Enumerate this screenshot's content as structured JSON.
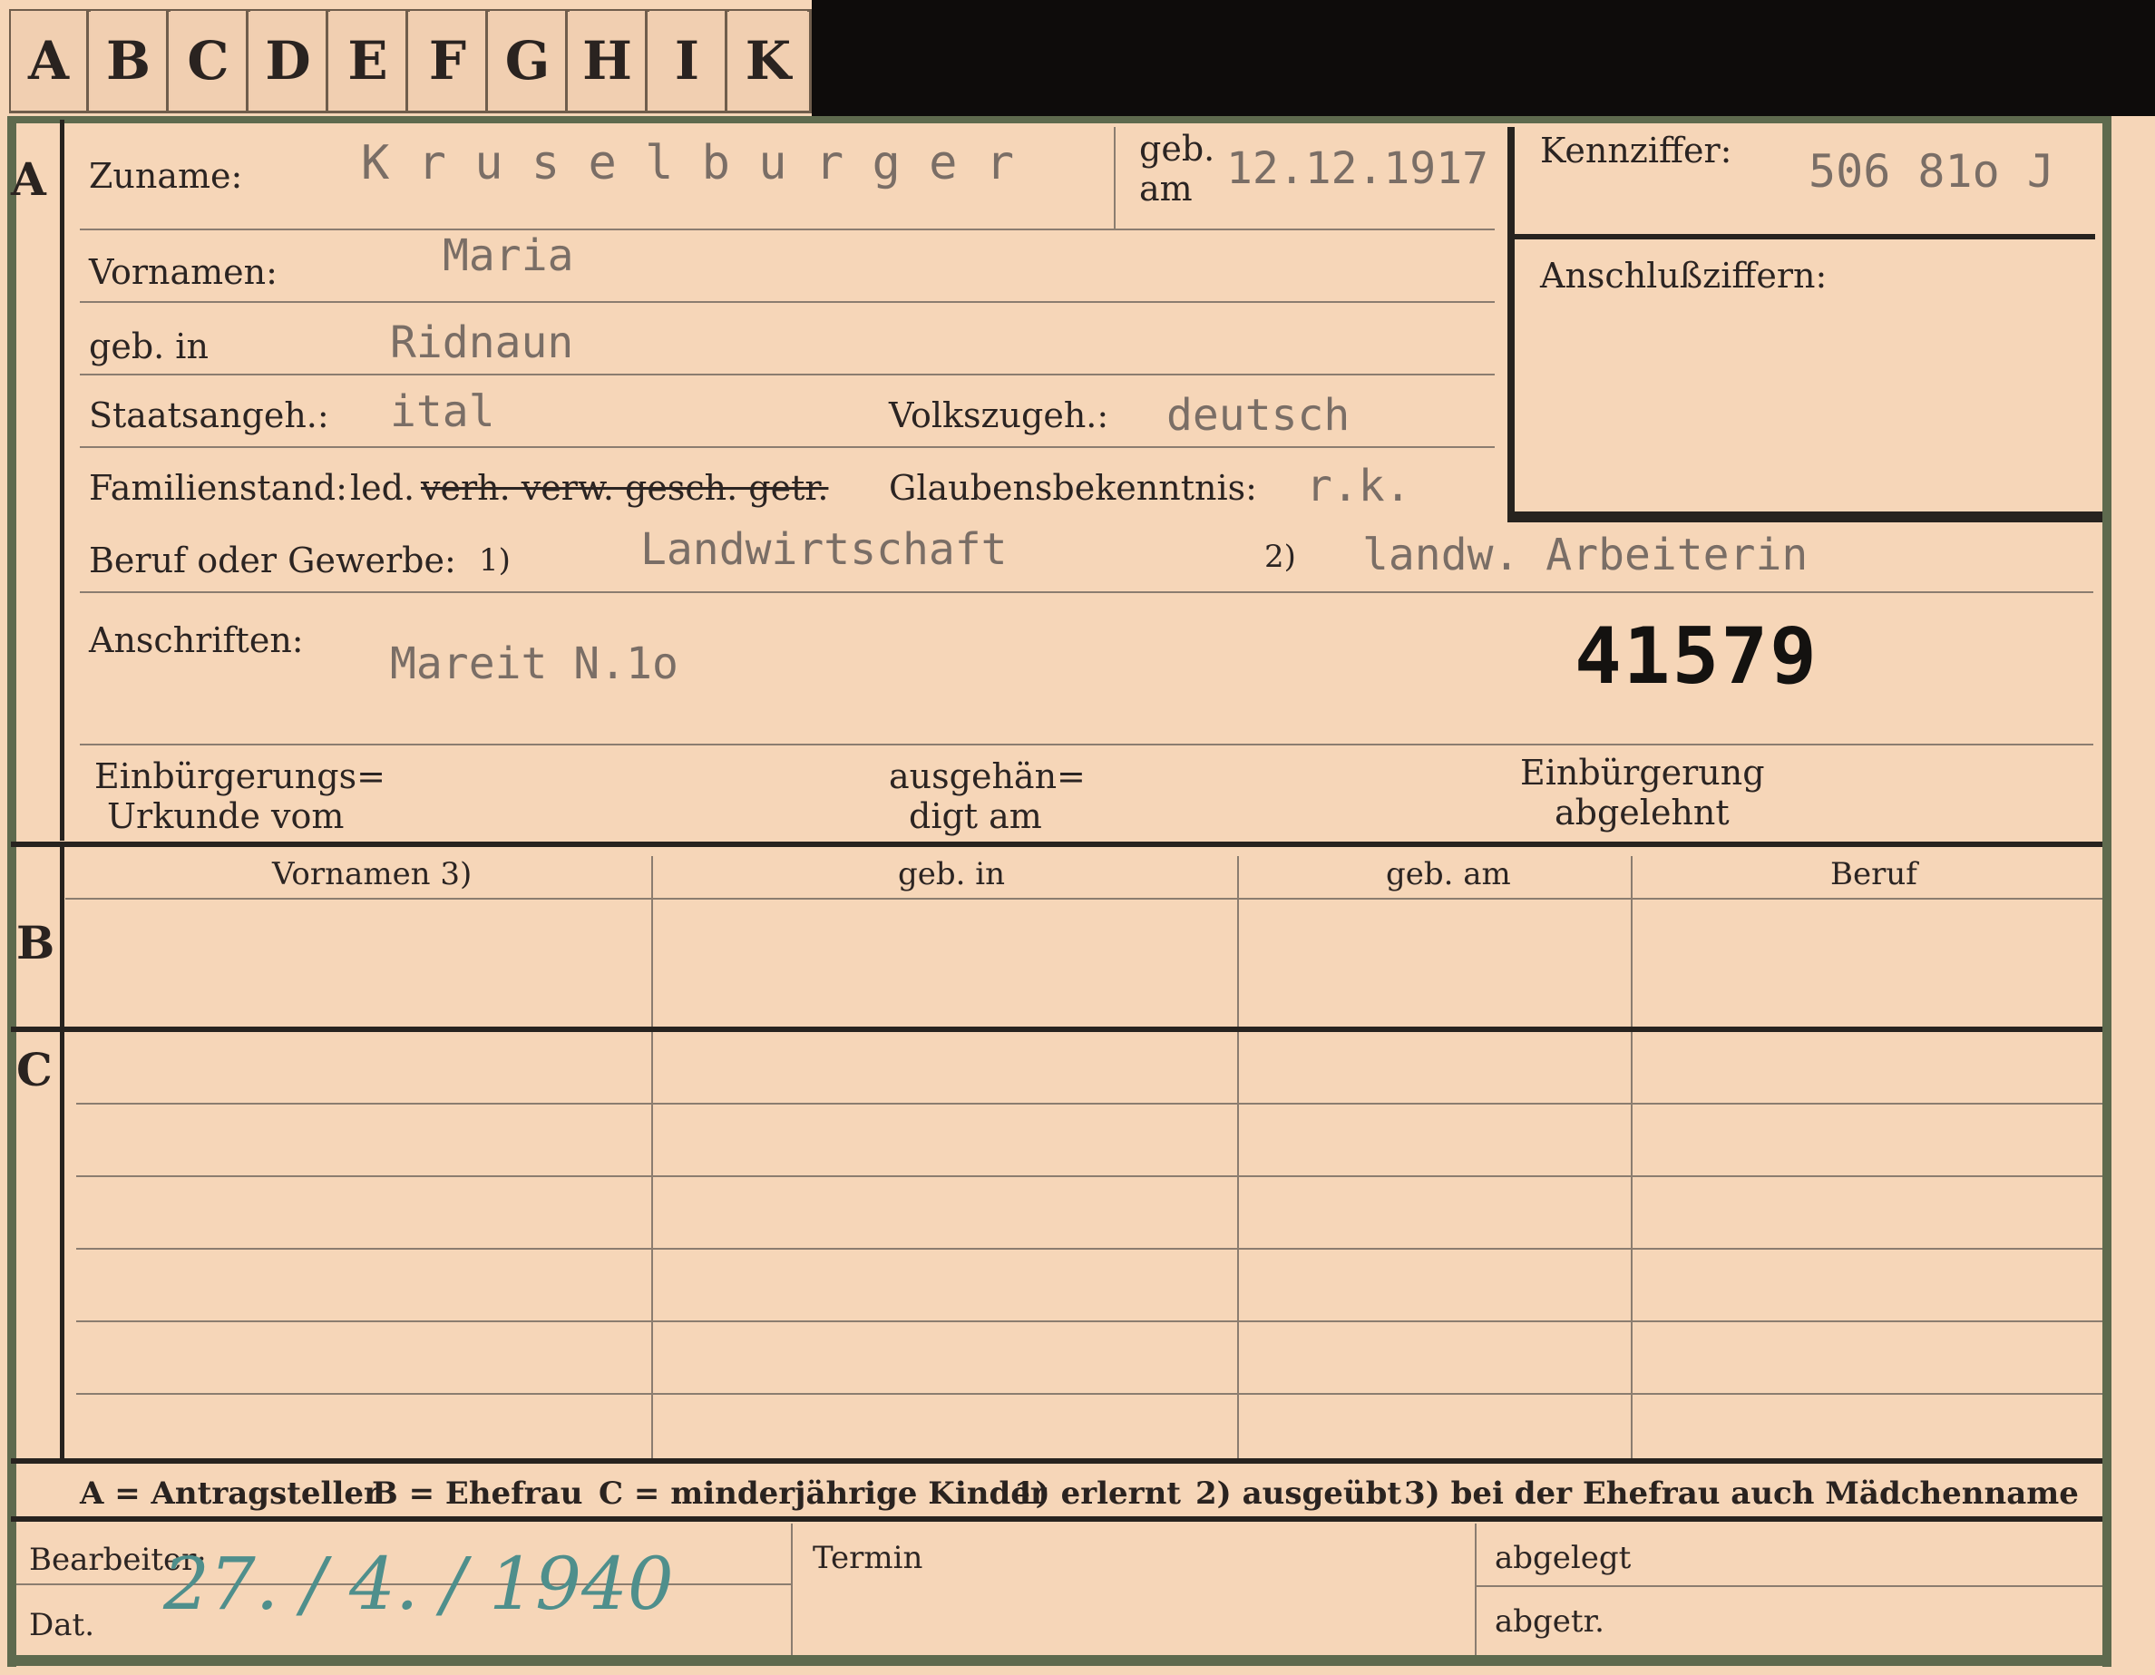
{
  "tabs": [
    "A",
    "B",
    "C",
    "D",
    "E",
    "F",
    "G",
    "H",
    "I",
    "K"
  ],
  "sections": {
    "a": "A",
    "b": "B",
    "c": "C"
  },
  "header": {
    "zuname_label": "Zuname:",
    "zuname_value": "K r u s e l b u r g   e r",
    "geb_am_label": "geb.",
    "geb_am_label2": "am",
    "geb_am_value": "12.12.1917",
    "kennziffer_label": "Kennziffer:",
    "kennziffer_value": "506 81o  J",
    "anschluss_label": "Anschlußziffern:"
  },
  "fields": {
    "vornamen_label": "Vornamen:",
    "vornamen_value": "Maria",
    "geb_in_label": "geb. in",
    "geb_in_value": "Ridnaun",
    "staat_label": "Staatsangeh.:",
    "staat_value": "ital",
    "volk_label": "Volkszugeh.:",
    "volk_value": "deutsch",
    "familienstand_label": "Familienstand:",
    "familienstand_led": "led.",
    "familienstand_struck": "verh. verw. gesch. getr.",
    "glauben_label": "Glaubensbekenntnis:",
    "glauben_value": "r.k.",
    "beruf_label": "Beruf oder Gewerbe:",
    "beruf_mark1": "1)",
    "beruf_value1": "Landwirtschaft",
    "beruf_mark2": "2)",
    "beruf_value2": "landw. Arbeiterin",
    "anschriften_label": "Anschriften:",
    "anschriften_value": "Mareit  N.1o",
    "stamp_number": "41579",
    "einb_label1": "Einbürgerungs=",
    "einb_label2": "Urkunde vom",
    "ausg_label1": "ausgehän=",
    "ausg_label2": "digt am",
    "abgel_label1": "Einbürgerung",
    "abgel_label2": "abgelehnt"
  },
  "table": {
    "headers": [
      "Vornamen 3)",
      "geb. in",
      "geb. am",
      "Beruf"
    ]
  },
  "legend": {
    "a": "A = Antragsteller",
    "b": "B = Ehefrau",
    "c": "C = minderjährige Kinder",
    "n1": "1) erlernt",
    "n2": "2) ausgeübt",
    "n3": "3) bei der Ehefrau auch Mädchenname"
  },
  "footer": {
    "bearbeiter_label": "Bearbeiter:",
    "dat_label": "Dat.",
    "date_handwritten": "27. / 4. / 1940",
    "termin_label": "Termin",
    "abgelegt_label": "abgelegt",
    "abgetr_label": "abgetr."
  },
  "colors": {
    "card": "#f6d6b8",
    "ink": "#2b2422",
    "typed": "#7a6e66",
    "handwriting": "#4f8f8c",
    "border_green": "#5e6a4e"
  }
}
